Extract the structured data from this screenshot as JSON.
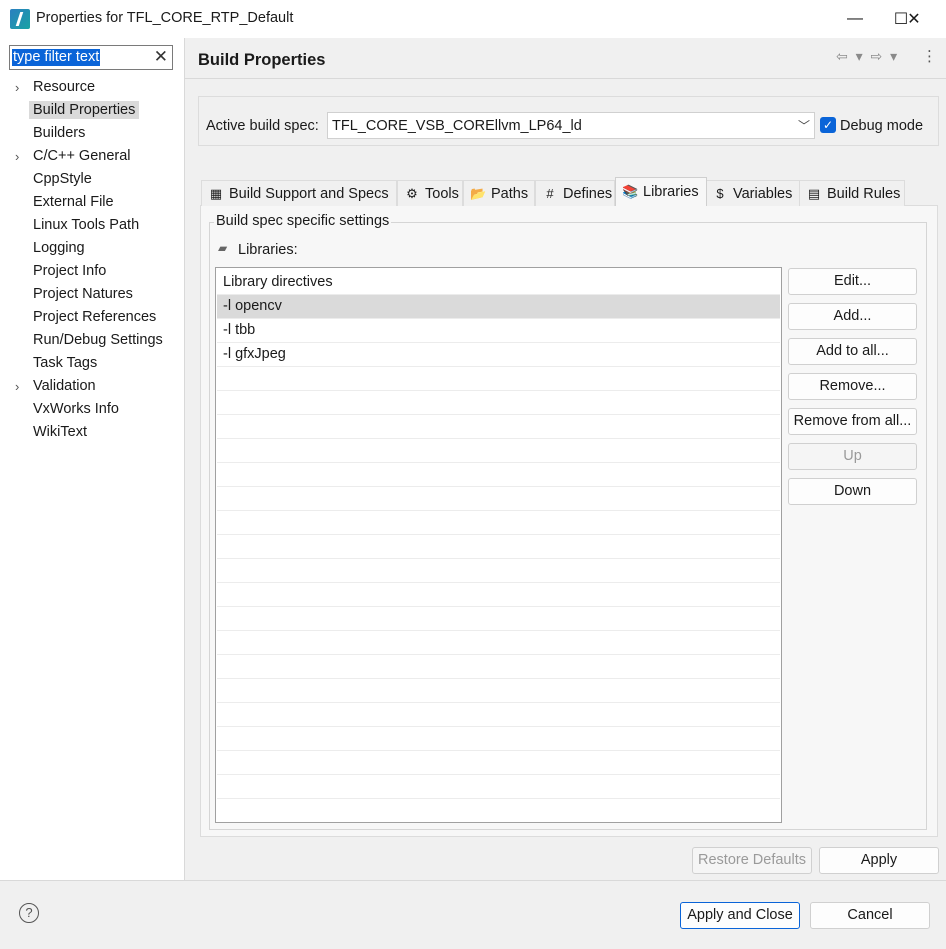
{
  "window": {
    "title": "Properties for TFL_CORE_RTP_Default",
    "minimize": "—",
    "maximize": "☐",
    "close": "✕"
  },
  "filter": {
    "value": "type filter text",
    "clear_glyph": "✕"
  },
  "tree": {
    "items": [
      {
        "label": "Resource",
        "expandable": true
      },
      {
        "label": "Build Properties",
        "selected": true
      },
      {
        "label": "Builders"
      },
      {
        "label": "C/C++ General",
        "expandable": true
      },
      {
        "label": "CppStyle"
      },
      {
        "label": "External File"
      },
      {
        "label": "Linux Tools Path"
      },
      {
        "label": "Logging"
      },
      {
        "label": "Project Info"
      },
      {
        "label": "Project Natures"
      },
      {
        "label": "Project References"
      },
      {
        "label": "Run/Debug Settings"
      },
      {
        "label": "Task Tags"
      },
      {
        "label": "Validation",
        "expandable": true
      },
      {
        "label": "VxWorks Info"
      },
      {
        "label": "WikiText"
      }
    ]
  },
  "page": {
    "title": "Build Properties",
    "nav": "⇦ ▾ ⇨ ▾",
    "more": "⋮"
  },
  "spec": {
    "label": "Active build spec:",
    "value": "TFL_CORE_VSB_COREllvm_LP64_ld",
    "debug_label": "Debug mode",
    "debug_checked": true
  },
  "tabs": [
    {
      "label": "Build Support and Specs",
      "icon": "build-support-icon",
      "glyph": "▦"
    },
    {
      "label": "Tools",
      "icon": "tools-icon",
      "glyph": "⚙"
    },
    {
      "label": "Paths",
      "icon": "folder-icon",
      "glyph": "📂"
    },
    {
      "label": "Defines",
      "icon": "hash-icon",
      "glyph": "#"
    },
    {
      "label": "Libraries",
      "icon": "libraries-icon",
      "glyph": "📚",
      "active": true
    },
    {
      "label": "Variables",
      "icon": "dollar-icon",
      "glyph": "$"
    },
    {
      "label": "Build Rules",
      "icon": "build-rules-icon",
      "glyph": "▤"
    }
  ],
  "libraries": {
    "group_title": "Build spec specific settings",
    "label": "Libraries:",
    "rows": [
      "Library directives",
      "-l opencv",
      "-l tbb",
      "-l gfxJpeg"
    ],
    "selected_index": 1
  },
  "side_buttons": [
    {
      "label": "Edit...",
      "enabled": true
    },
    {
      "label": "Add...",
      "enabled": true
    },
    {
      "label": "Add to all...",
      "enabled": true
    },
    {
      "label": "Remove...",
      "enabled": true
    },
    {
      "label": "Remove from all...",
      "enabled": true
    },
    {
      "label": "Up",
      "enabled": false
    },
    {
      "label": "Down",
      "enabled": true
    }
  ],
  "footer": {
    "restore_defaults": "Restore Defaults",
    "apply": "Apply",
    "apply_and_close": "Apply and Close",
    "cancel": "Cancel",
    "help": "?"
  }
}
